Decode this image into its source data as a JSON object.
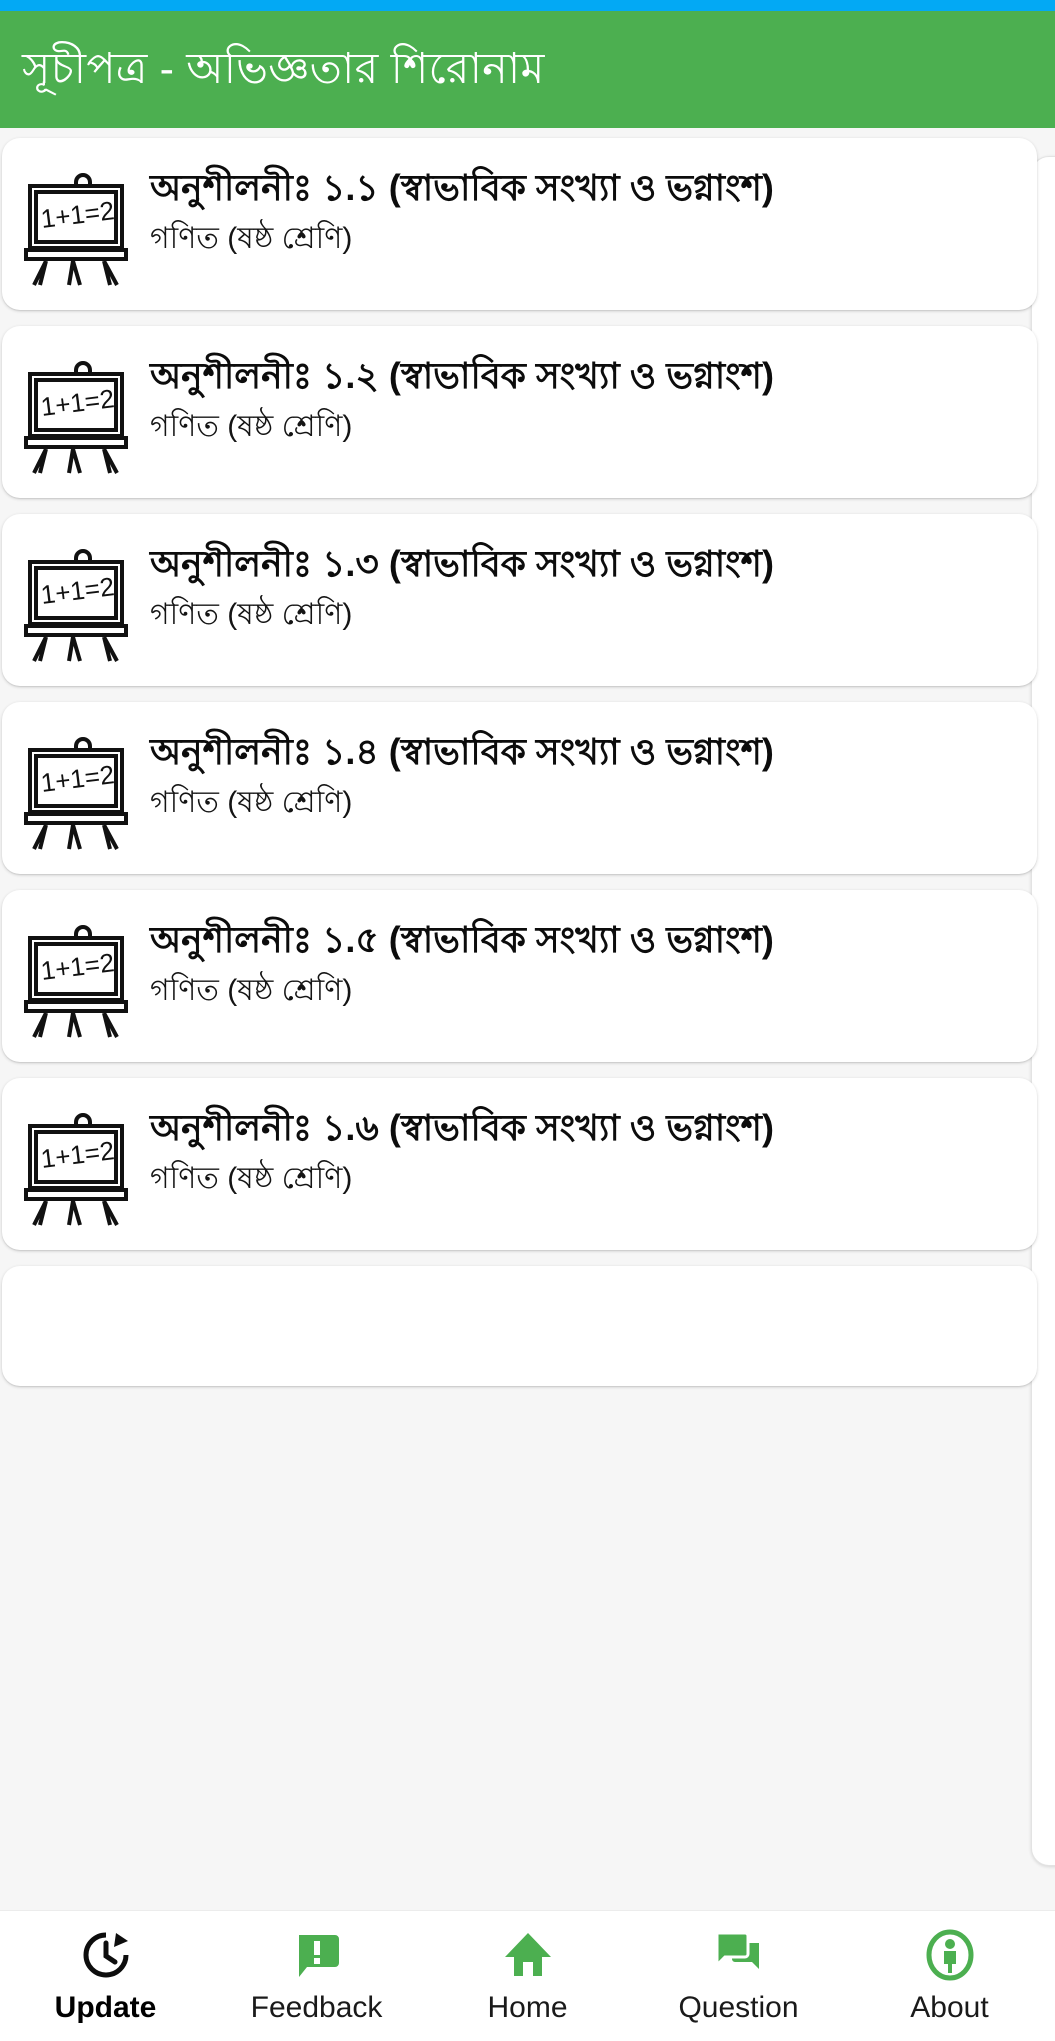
{
  "colors": {
    "status_bar": "#03A9F4",
    "app_bar": "#4CAF50",
    "accent_green": "#4CAF50",
    "card_background": "#FFFFFF",
    "page_background": "#F6F6F6",
    "selected_nav": "#000000"
  },
  "app_bar": {
    "title": "সূচীপত্র - অভিজ্ঞতার শিরোনাম"
  },
  "list": {
    "icon_name": "blackboard-easel-icon",
    "icon_text": "1+1=2",
    "items": [
      {
        "title": "অনুশীলনীঃ ১.১ (স্বাভাবিক সংখ্যা ও ভগ্নাংশ)",
        "subtitle": "গণিত (ষষ্ঠ শ্রেণি)"
      },
      {
        "title": "অনুশীলনীঃ ১.২  (স্বাভাবিক সংখ্যা ও ভগ্নাংশ)",
        "subtitle": "গণিত (ষষ্ঠ শ্রেণি)"
      },
      {
        "title": "অনুশীলনীঃ ১.৩  (স্বাভাবিক সংখ্যা ও ভগ্নাংশ)",
        "subtitle": "গণিত (ষষ্ঠ শ্রেণি)"
      },
      {
        "title": "অনুশীলনীঃ ১.৪ (স্বাভাবিক সংখ্যা ও ভগ্নাংশ)",
        "subtitle": "গণিত (ষষ্ঠ শ্রেণি)"
      },
      {
        "title": "অনুশীলনীঃ ১.৫ (স্বাভাবিক সংখ্যা ও ভগ্নাংশ)",
        "subtitle": "গণিত (ষষ্ঠ শ্রেণি)"
      },
      {
        "title": "অনুশীলনীঃ ১.৬  (স্বাভাবিক সংখ্যা ও ভগ্নাংশ)",
        "subtitle": "গণিত (ষষ্ঠ শ্রেণি)"
      }
    ]
  },
  "bottom_nav": {
    "items": [
      {
        "label": "Update",
        "icon": "update-clock-icon",
        "selected": true
      },
      {
        "label": "Feedback",
        "icon": "feedback-bubble-icon",
        "selected": false
      },
      {
        "label": "Home",
        "icon": "home-icon",
        "selected": false
      },
      {
        "label": "Question",
        "icon": "forum-bubbles-icon",
        "selected": false
      },
      {
        "label": "About",
        "icon": "person-info-icon",
        "selected": false
      }
    ]
  }
}
